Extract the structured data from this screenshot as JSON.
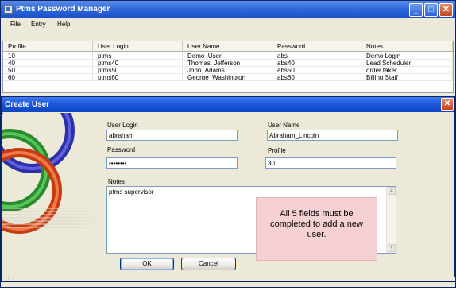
{
  "window": {
    "title": "Ptms Password Manager",
    "controls": {
      "minimize": "_",
      "maximize": "□",
      "close": "✕"
    }
  },
  "menu": [
    "File",
    "Entry",
    "Help"
  ],
  "grid": {
    "headers": [
      "Profile",
      "User Login",
      "User Name",
      "Password",
      "Notes"
    ],
    "rows": [
      [
        "10",
        "ptms",
        "Demo_User",
        "abs",
        "Demo Login"
      ],
      [
        "40",
        "ptms40",
        "Thomas_Jefferson",
        "abs40",
        "Lead Scheduler"
      ],
      [
        "50",
        "ptms50",
        "John_Adams",
        "abs50",
        "order taker"
      ],
      [
        "60",
        "ptms60",
        "George_Washington",
        "abs60",
        "Billing Staff"
      ]
    ]
  },
  "dialog": {
    "title": "Create User",
    "close_glyph": "✕",
    "fields": {
      "user_login": {
        "label": "User Login",
        "value": "abraham"
      },
      "password": {
        "label": "Password",
        "value": "••••••••"
      },
      "user_name": {
        "label": "User Name",
        "value": "Abraham_Lincoln"
      },
      "profile": {
        "label": "Profile",
        "value": "30"
      },
      "notes": {
        "label": "Notes",
        "value": "ptms supervisor"
      }
    },
    "callout": "All 5 fields must be completed to add a new user.",
    "ok_label": "OK",
    "cancel_label": "Cancel",
    "scroll_up_glyph": "▲",
    "scroll_down_glyph": "▼",
    "resize_grip": "⋮⋮",
    "art_colors": {
      "blue": "#3a3fc2",
      "green": "#36a23a",
      "red": "#e04e20"
    }
  }
}
